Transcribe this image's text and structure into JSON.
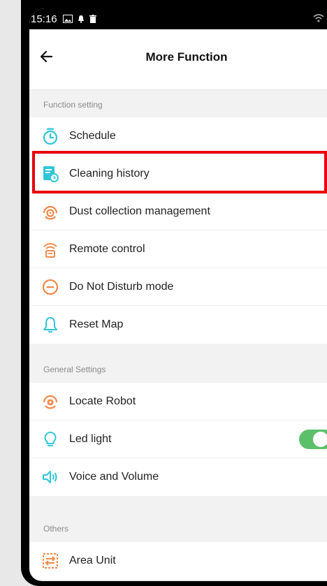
{
  "status_bar": {
    "time": "15:16"
  },
  "header": {
    "title": "More Function"
  },
  "sections": {
    "function_setting": {
      "title": "Function setting",
      "items": [
        {
          "label": "Schedule",
          "icon": "timer-icon"
        },
        {
          "label": "Cleaning history",
          "icon": "history-document-icon"
        },
        {
          "label": "Dust collection management",
          "icon": "dust-collection-icon"
        },
        {
          "label": "Remote control",
          "icon": "remote-control-icon"
        },
        {
          "label": "Do Not Disturb mode",
          "icon": "do-not-disturb-icon"
        },
        {
          "label": "Reset Map",
          "icon": "bell-icon"
        }
      ]
    },
    "general_settings": {
      "title": "General Settings",
      "items": [
        {
          "label": "Locate Robot",
          "icon": "locate-robot-icon"
        },
        {
          "label": "Led light",
          "icon": "bulb-icon",
          "toggle": true
        },
        {
          "label": "Voice and Volume",
          "icon": "speaker-icon"
        }
      ]
    },
    "others": {
      "title": "Others",
      "items": [
        {
          "label": "Area Unit",
          "icon": "area-unit-icon"
        }
      ]
    }
  },
  "colors": {
    "accent_orange": "#f08a4b",
    "accent_cyan": "#2fc6d9",
    "toggle_on": "#5cbf6a",
    "highlight": "#e8000b"
  }
}
